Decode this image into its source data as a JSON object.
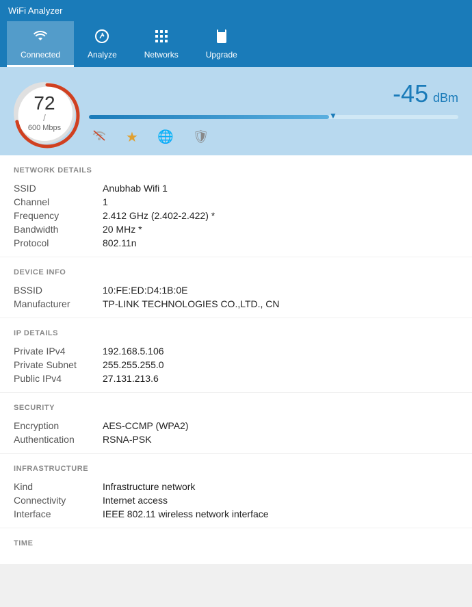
{
  "app": {
    "title": "WiFi Analyzer"
  },
  "nav": {
    "items": [
      {
        "id": "connected",
        "label": "Connected",
        "icon": "wifi",
        "active": true
      },
      {
        "id": "analyze",
        "label": "Analyze",
        "icon": "chart",
        "active": false
      },
      {
        "id": "networks",
        "label": "Networks",
        "icon": "grid",
        "active": false
      },
      {
        "id": "upgrade",
        "label": "Upgrade",
        "icon": "bag",
        "active": false
      }
    ]
  },
  "signal": {
    "score": "72",
    "score_suffix": "/",
    "speed": "600 Mbps",
    "dbm": "-45",
    "dbm_unit": "dBm",
    "bar_fill_pct": "65"
  },
  "network_details": {
    "section_title": "NETWORK DETAILS",
    "ssid_label": "SSID",
    "ssid_value": "Anubhab Wifi 1",
    "channel_label": "Channel",
    "channel_value": "1",
    "frequency_label": "Frequency",
    "frequency_value": "2.412 GHz  (2.402-2.422) *",
    "bandwidth_label": "Bandwidth",
    "bandwidth_value": "20 MHz *",
    "protocol_label": "Protocol",
    "protocol_value": "802.11n"
  },
  "device_info": {
    "section_title": "DEVICE INFO",
    "bssid_label": "BSSID",
    "bssid_value": "10:FE:ED:D4:1B:0E",
    "manufacturer_label": "Manufacturer",
    "manufacturer_value": "TP-LINK TECHNOLOGIES CO.,LTD., CN"
  },
  "ip_details": {
    "section_title": "IP DETAILS",
    "private_ipv4_label": "Private IPv4",
    "private_ipv4_value": "192.168.5.106",
    "private_subnet_label": "Private Subnet",
    "private_subnet_value": "255.255.255.0",
    "public_ipv4_label": "Public IPv4",
    "public_ipv4_value": "27.131.213.6"
  },
  "security": {
    "section_title": "SECURITY",
    "encryption_label": "Encryption",
    "encryption_value": "AES-CCMP (WPA2)",
    "authentication_label": "Authentication",
    "authentication_value": "RSNA-PSK"
  },
  "infrastructure": {
    "section_title": "INFRASTRUCTURE",
    "kind_label": "Kind",
    "kind_value": "Infrastructure network",
    "connectivity_label": "Connectivity",
    "connectivity_value": "Internet access",
    "interface_label": "Interface",
    "interface_value": "IEEE 802.11 wireless network interface"
  },
  "time": {
    "section_title": "TIME"
  },
  "colors": {
    "accent": "#1a7bb9",
    "nav_bg": "#1a7bb9",
    "signal_bg": "#b8d9ef"
  }
}
